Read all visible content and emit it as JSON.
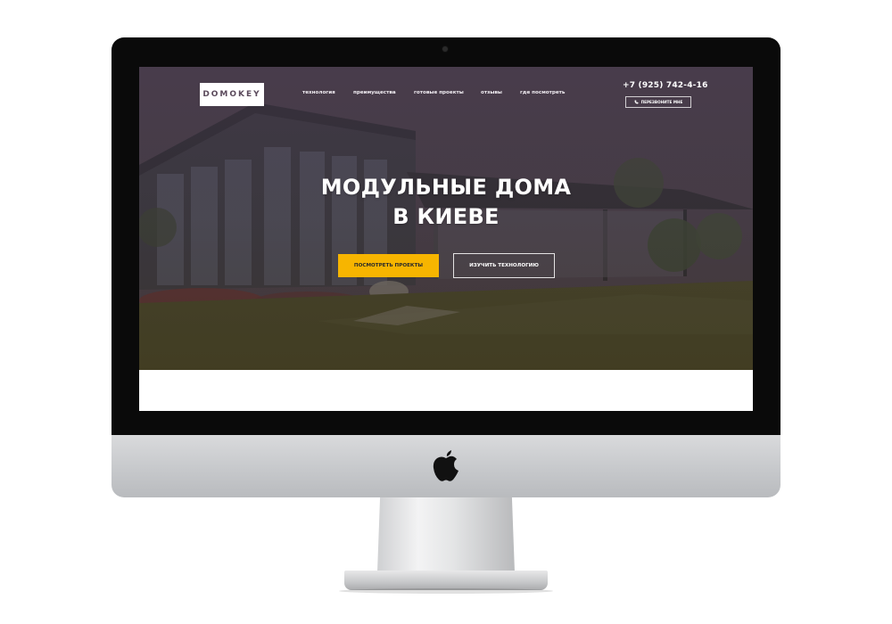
{
  "site": {
    "logo": "DOMOKEY",
    "nav": [
      {
        "label": "технология"
      },
      {
        "label": "преимущества"
      },
      {
        "label": "готовые проекты"
      },
      {
        "label": "отзывы"
      },
      {
        "label": "где посмотреть"
      }
    ],
    "phone": "+7 (925) 742-4-16",
    "callback_label": "ПЕРЕЗВОНИТЕ МНЕ",
    "headline_line1": "МОДУЛЬНЫЕ ДОМА",
    "headline_line2": "В КИЕВЕ",
    "primary_button": "ПОСМОТРЕТЬ ПРОЕКТЫ",
    "secondary_button": "ИЗУЧИТЬ ТЕХНОЛОГИЮ"
  },
  "colors": {
    "accent": "#f7b500",
    "logo_text": "#5b4a5c",
    "bezel": "#0a0a0a",
    "chin": "#c5c7ca"
  },
  "icons": {
    "phone": "phone-icon",
    "brand": "apple-logo-icon",
    "camera": "camera-dot"
  }
}
